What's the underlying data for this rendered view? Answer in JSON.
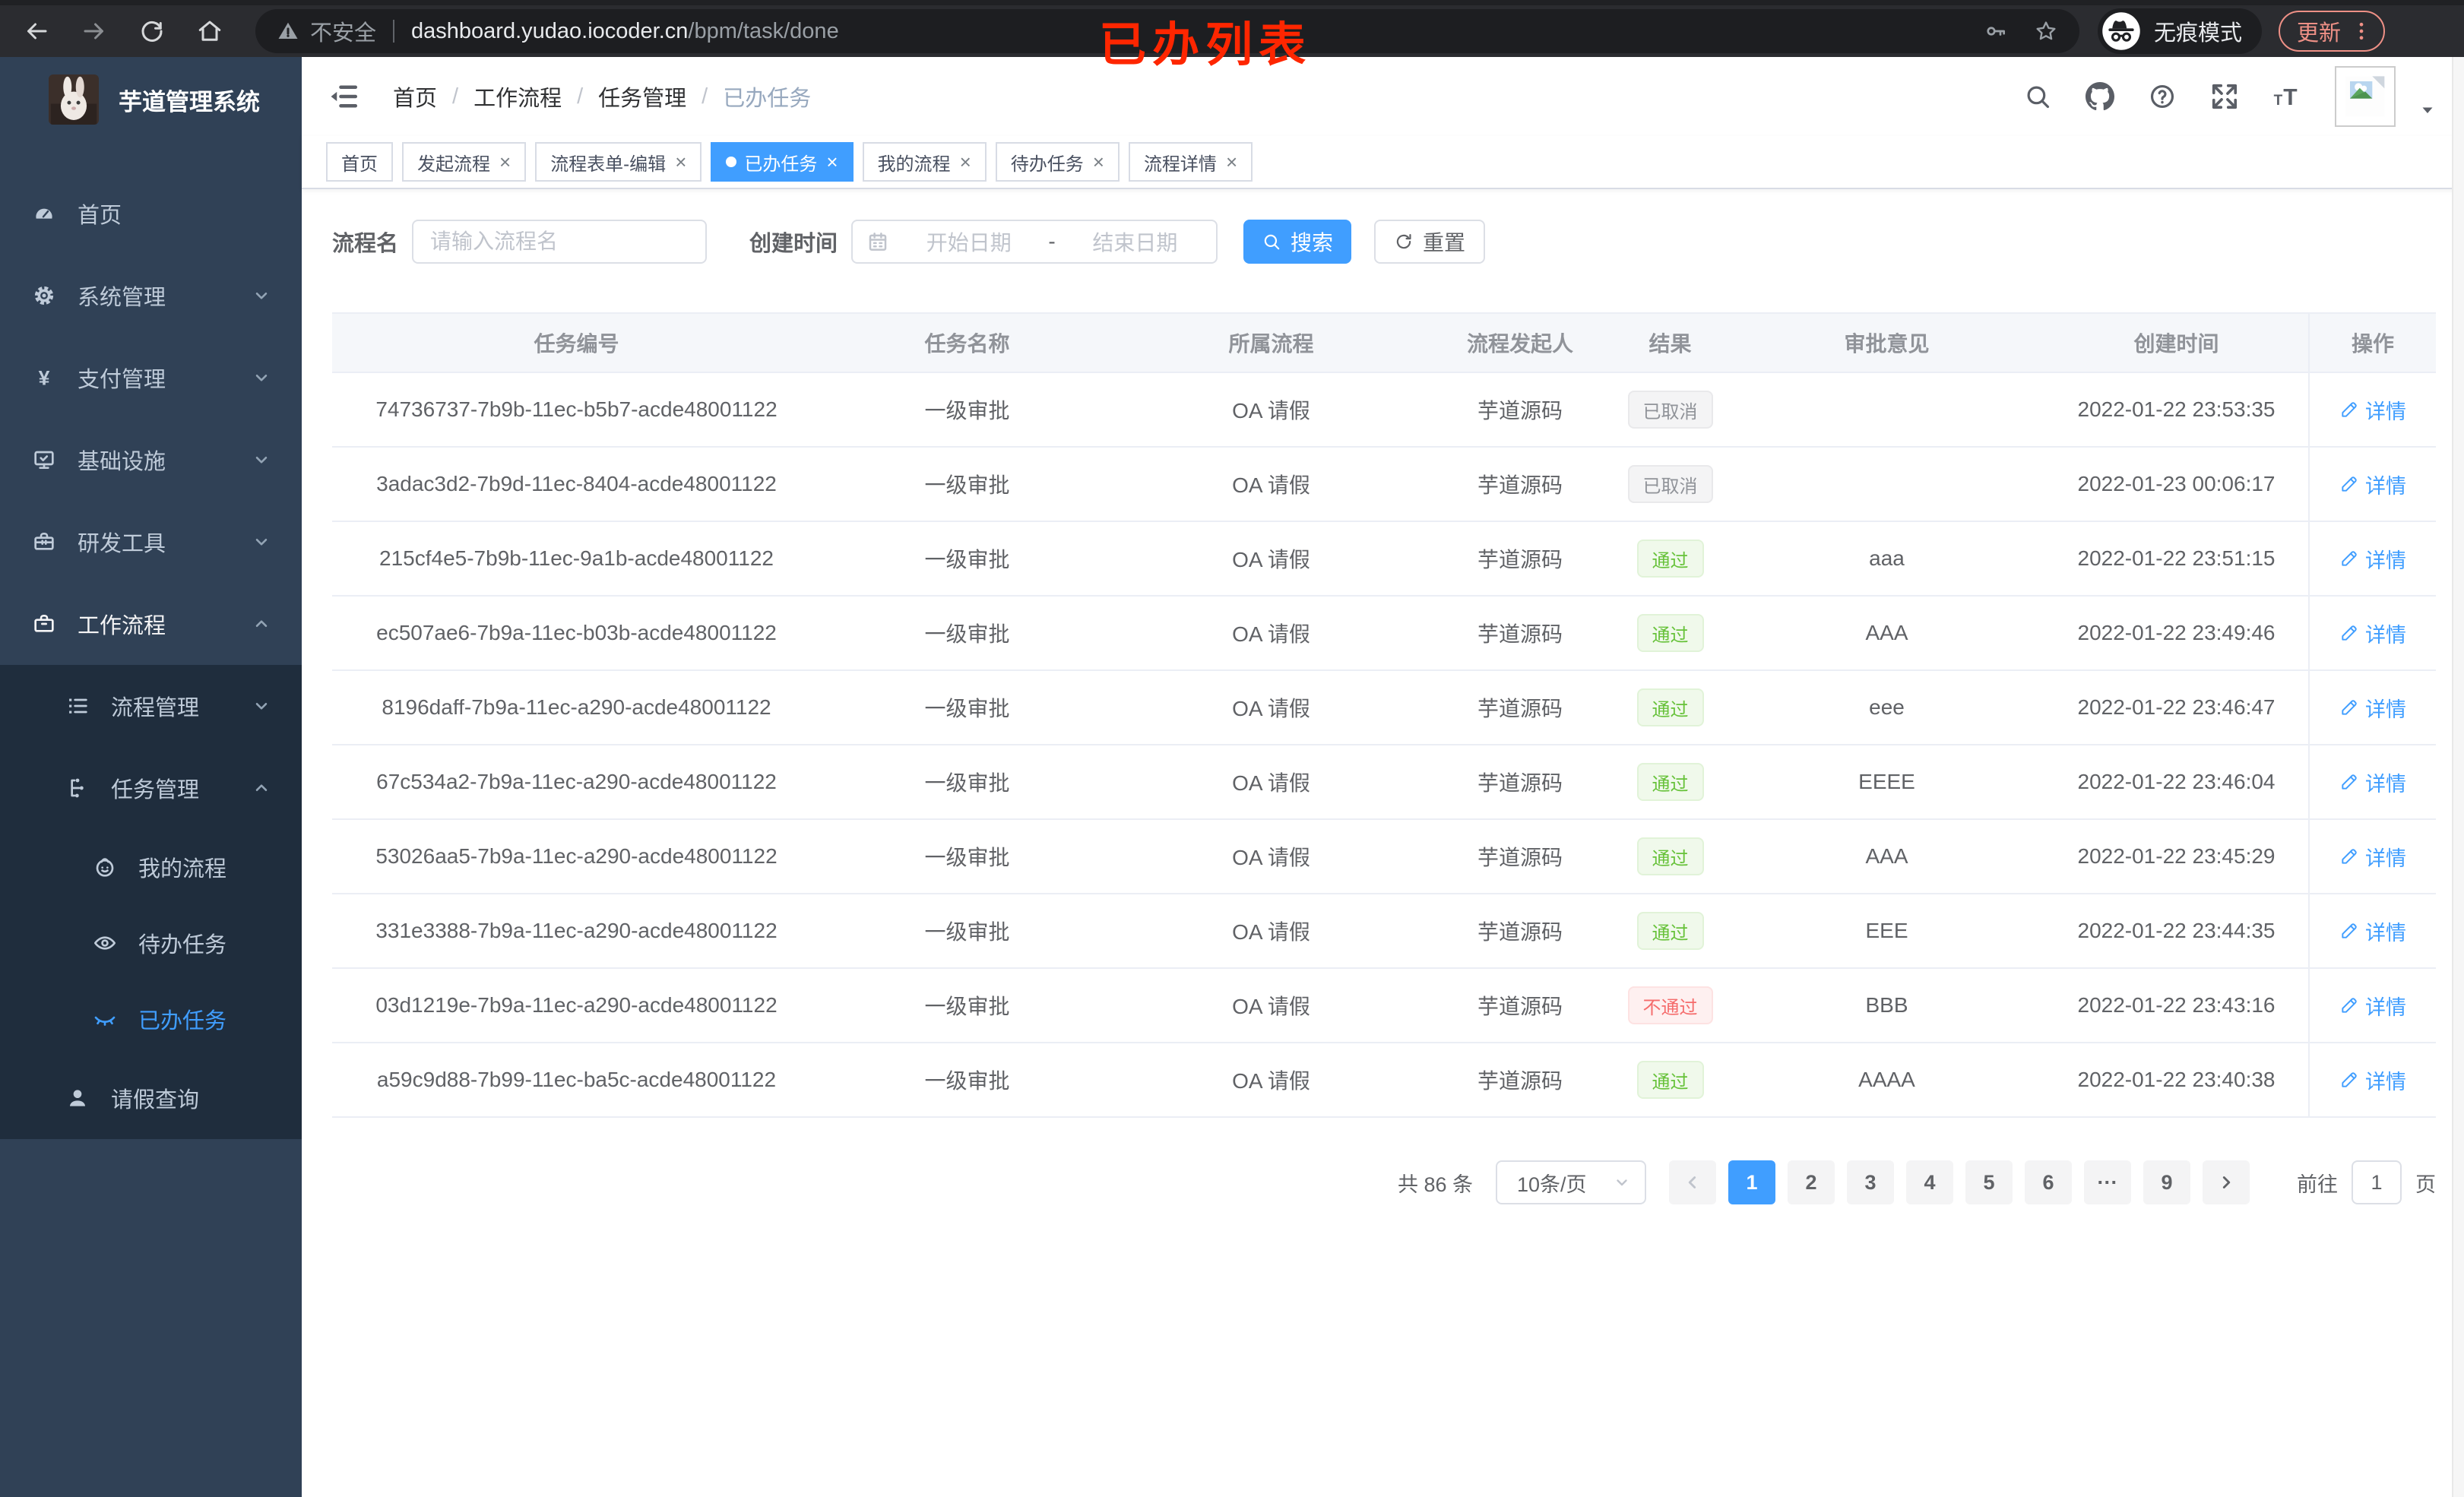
{
  "colors": {
    "accent": "#409eff",
    "success": "#67c23a",
    "danger": "#f56c6c",
    "info": "#909399",
    "sidebar_bg": "#304156",
    "sidebar_sub_bg": "#1f2d3d",
    "annotation_red": "#fe2600",
    "chrome_update": "#ee9086"
  },
  "browser": {
    "nav_icons": [
      "back-icon",
      "forward-icon",
      "reload-icon",
      "home-icon"
    ],
    "security_label": "不安全",
    "url_host": "dashboard.yudao.iocoder.cn",
    "url_path": "/bpm/task/done",
    "omnibox_icons": [
      "key-icon",
      "star-icon"
    ],
    "incognito_label": "无痕模式",
    "update_label": "更新"
  },
  "annotation": {
    "text": "已办列表"
  },
  "sidebar": {
    "title": "芋道管理系统",
    "logo_icon": "rabbit-logo",
    "menu": [
      {
        "label": "首页",
        "icon": "gauge-icon",
        "level": 0
      },
      {
        "label": "系统管理",
        "icon": "gear-icon",
        "level": 0,
        "chevron": "down"
      },
      {
        "label": "支付管理",
        "icon": "yen-icon",
        "level": 0,
        "chevron": "down"
      },
      {
        "label": "基础设施",
        "icon": "monitor-icon",
        "level": 0,
        "chevron": "down"
      },
      {
        "label": "研发工具",
        "icon": "toolbox-icon",
        "level": 0,
        "chevron": "down"
      },
      {
        "label": "工作流程",
        "icon": "briefcase-icon",
        "level": 0,
        "chevron": "up",
        "active_parent": true
      },
      {
        "label": "流程管理",
        "icon": "list-icon",
        "level": 1,
        "chevron": "down",
        "sub": true
      },
      {
        "label": "任务管理",
        "icon": "flow-icon",
        "level": 1,
        "chevron": "up",
        "sub": true
      },
      {
        "label": "我的流程",
        "icon": "face-icon",
        "level": 2,
        "sub": true
      },
      {
        "label": "待办任务",
        "icon": "eye-icon",
        "level": 2,
        "sub": true
      },
      {
        "label": "已办任务",
        "icon": "eye-closed-icon",
        "level": 2,
        "sub": true,
        "active": true
      },
      {
        "label": "请假查询",
        "icon": "user-icon",
        "level": 1,
        "sub": true
      }
    ]
  },
  "header": {
    "breadcrumb": [
      "首页",
      "工作流程",
      "任务管理",
      "已办任务"
    ],
    "right_icons": [
      "search-icon",
      "github-icon",
      "question-icon",
      "fullscreen-icon",
      "font-size-icon"
    ]
  },
  "tabs": [
    {
      "label": "首页"
    },
    {
      "label": "发起流程",
      "closable": true
    },
    {
      "label": "流程表单-编辑",
      "closable": true
    },
    {
      "label": "已办任务",
      "closable": true,
      "active": true
    },
    {
      "label": "我的流程",
      "closable": true
    },
    {
      "label": "待办任务",
      "closable": true
    },
    {
      "label": "流程详情",
      "closable": true
    }
  ],
  "filters": {
    "name_label": "流程名",
    "name_placeholder": "请输入流程名",
    "time_label": "创建时间",
    "start_placeholder": "开始日期",
    "range_separator": "-",
    "end_placeholder": "结束日期",
    "search_label": "搜索",
    "reset_label": "重置"
  },
  "table": {
    "headers": [
      "任务编号",
      "任务名称",
      "所属流程",
      "流程发起人",
      "结果",
      "审批意见",
      "创建时间",
      "操作"
    ],
    "action_label": "详情",
    "rows": [
      {
        "id": "74736737-7b9b-11ec-b5b7-acde48001122",
        "name": "一级审批",
        "process": "OA 请假",
        "starter": "芋道源码",
        "result": "已取消",
        "result_type": "info",
        "comment": "",
        "time": "2022-01-22 23:53:35"
      },
      {
        "id": "3adac3d2-7b9d-11ec-8404-acde48001122",
        "name": "一级审批",
        "process": "OA 请假",
        "starter": "芋道源码",
        "result": "已取消",
        "result_type": "info",
        "comment": "",
        "time": "2022-01-23 00:06:17"
      },
      {
        "id": "215cf4e5-7b9b-11ec-9a1b-acde48001122",
        "name": "一级审批",
        "process": "OA 请假",
        "starter": "芋道源码",
        "result": "通过",
        "result_type": "success",
        "comment": "aaa",
        "time": "2022-01-22 23:51:15"
      },
      {
        "id": "ec507ae6-7b9a-11ec-b03b-acde48001122",
        "name": "一级审批",
        "process": "OA 请假",
        "starter": "芋道源码",
        "result": "通过",
        "result_type": "success",
        "comment": "AAA",
        "time": "2022-01-22 23:49:46"
      },
      {
        "id": "8196daff-7b9a-11ec-a290-acde48001122",
        "name": "一级审批",
        "process": "OA 请假",
        "starter": "芋道源码",
        "result": "通过",
        "result_type": "success",
        "comment": "eee",
        "time": "2022-01-22 23:46:47"
      },
      {
        "id": "67c534a2-7b9a-11ec-a290-acde48001122",
        "name": "一级审批",
        "process": "OA 请假",
        "starter": "芋道源码",
        "result": "通过",
        "result_type": "success",
        "comment": "EEEE",
        "time": "2022-01-22 23:46:04"
      },
      {
        "id": "53026aa5-7b9a-11ec-a290-acde48001122",
        "name": "一级审批",
        "process": "OA 请假",
        "starter": "芋道源码",
        "result": "通过",
        "result_type": "success",
        "comment": "AAA",
        "time": "2022-01-22 23:45:29"
      },
      {
        "id": "331e3388-7b9a-11ec-a290-acde48001122",
        "name": "一级审批",
        "process": "OA 请假",
        "starter": "芋道源码",
        "result": "通过",
        "result_type": "success",
        "comment": "EEE",
        "time": "2022-01-22 23:44:35"
      },
      {
        "id": "03d1219e-7b9a-11ec-a290-acde48001122",
        "name": "一级审批",
        "process": "OA 请假",
        "starter": "芋道源码",
        "result": "不通过",
        "result_type": "danger",
        "comment": "BBB",
        "time": "2022-01-22 23:43:16"
      },
      {
        "id": "a59c9d88-7b99-11ec-ba5c-acde48001122",
        "name": "一级审批",
        "process": "OA 请假",
        "starter": "芋道源码",
        "result": "通过",
        "result_type": "success",
        "comment": "AAAA",
        "time": "2022-01-22 23:40:38"
      }
    ]
  },
  "pagination": {
    "total": "共 86 条",
    "page_size": "10条/页",
    "pages": [
      "1",
      "2",
      "3",
      "4",
      "5",
      "6",
      "···",
      "9"
    ],
    "active_page": "1",
    "goto_label": "前往",
    "goto_value": "1",
    "unit_label": "页"
  }
}
